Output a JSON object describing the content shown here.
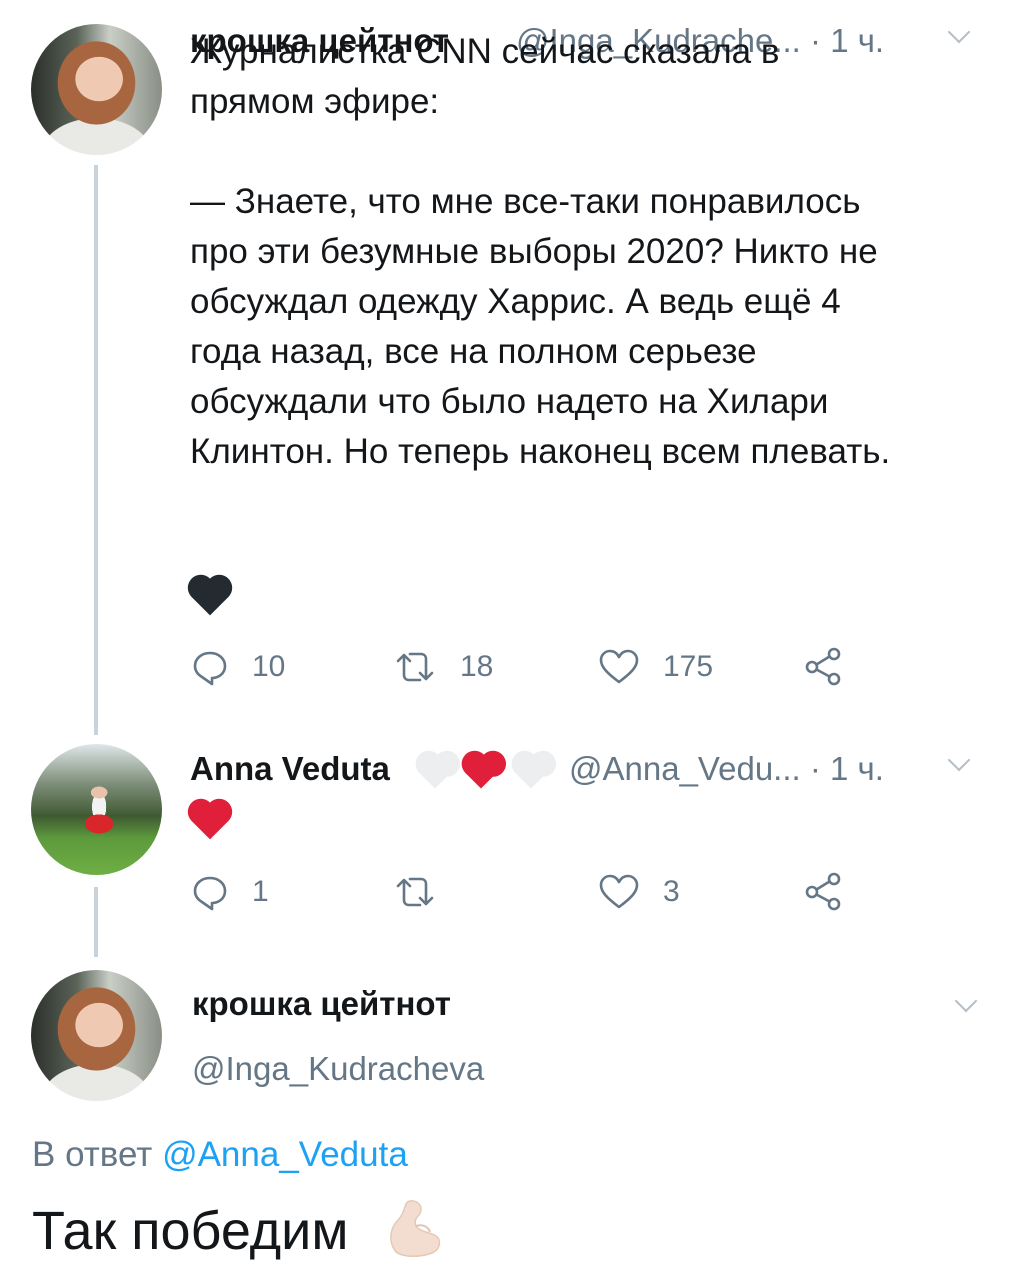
{
  "tweet1": {
    "display_name": "крошка цейтнот",
    "handle": "@Inga_Kudrache...",
    "time": "· 1 ч.",
    "text": "Журналистка CNN сейчас сказала в\nпрямом эфире:\n\n— Знаете, что мне все-таки понравилось\nпро эти безумные выборы 2020? Никто не\nобсуждал одежду Харрис. А ведь ещё 4\nгода назад, все на полном серьезе\nобсуждали что было надето на Хилари\nКлинтон. Но теперь наконец всем плевать.",
    "emoji_icon": "black-heart",
    "replies": "10",
    "retweets": "18",
    "likes": "175"
  },
  "tweet2": {
    "display_name": "Anna Veduta",
    "name_emoji_icons": [
      "white-heart",
      "red-heart",
      "white-heart"
    ],
    "handle": "@Anna_Vedu...",
    "time": "· 1 ч.",
    "emoji_icon": "red-heart",
    "replies": "1",
    "retweets": "",
    "likes": "3"
  },
  "tweet3": {
    "display_name": "крошка цейтнот",
    "handle": "@Inga_Kudracheva",
    "reply_prefix": "В ответ ",
    "reply_mention": "@Anna_Veduta",
    "text": "Так победим",
    "emoji_icon": "flexed-biceps"
  },
  "colors": {
    "text": "#14171a",
    "muted": "#657786",
    "link": "#1da1f2",
    "thread_line": "#c8d3db",
    "red_heart": "#e0203a"
  }
}
